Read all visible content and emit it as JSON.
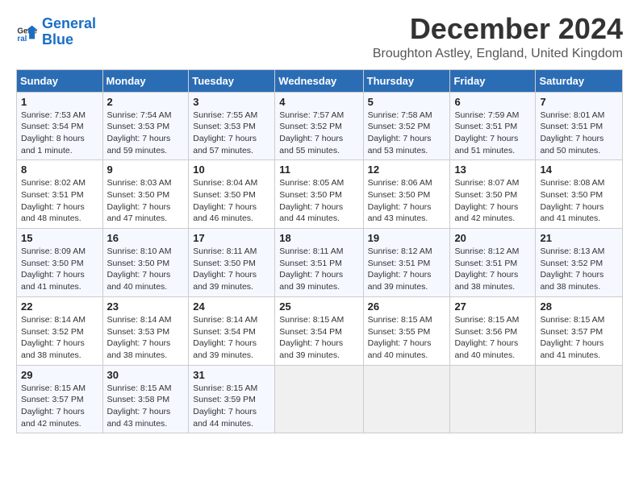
{
  "header": {
    "logo_line1": "General",
    "logo_line2": "Blue",
    "month": "December 2024",
    "location": "Broughton Astley, England, United Kingdom"
  },
  "days_of_week": [
    "Sunday",
    "Monday",
    "Tuesday",
    "Wednesday",
    "Thursday",
    "Friday",
    "Saturday"
  ],
  "weeks": [
    [
      {
        "day": "1",
        "info": "Sunrise: 7:53 AM\nSunset: 3:54 PM\nDaylight: 8 hours\nand 1 minute."
      },
      {
        "day": "2",
        "info": "Sunrise: 7:54 AM\nSunset: 3:53 PM\nDaylight: 7 hours\nand 59 minutes."
      },
      {
        "day": "3",
        "info": "Sunrise: 7:55 AM\nSunset: 3:53 PM\nDaylight: 7 hours\nand 57 minutes."
      },
      {
        "day": "4",
        "info": "Sunrise: 7:57 AM\nSunset: 3:52 PM\nDaylight: 7 hours\nand 55 minutes."
      },
      {
        "day": "5",
        "info": "Sunrise: 7:58 AM\nSunset: 3:52 PM\nDaylight: 7 hours\nand 53 minutes."
      },
      {
        "day": "6",
        "info": "Sunrise: 7:59 AM\nSunset: 3:51 PM\nDaylight: 7 hours\nand 51 minutes."
      },
      {
        "day": "7",
        "info": "Sunrise: 8:01 AM\nSunset: 3:51 PM\nDaylight: 7 hours\nand 50 minutes."
      }
    ],
    [
      {
        "day": "8",
        "info": "Sunrise: 8:02 AM\nSunset: 3:51 PM\nDaylight: 7 hours\nand 48 minutes."
      },
      {
        "day": "9",
        "info": "Sunrise: 8:03 AM\nSunset: 3:50 PM\nDaylight: 7 hours\nand 47 minutes."
      },
      {
        "day": "10",
        "info": "Sunrise: 8:04 AM\nSunset: 3:50 PM\nDaylight: 7 hours\nand 46 minutes."
      },
      {
        "day": "11",
        "info": "Sunrise: 8:05 AM\nSunset: 3:50 PM\nDaylight: 7 hours\nand 44 minutes."
      },
      {
        "day": "12",
        "info": "Sunrise: 8:06 AM\nSunset: 3:50 PM\nDaylight: 7 hours\nand 43 minutes."
      },
      {
        "day": "13",
        "info": "Sunrise: 8:07 AM\nSunset: 3:50 PM\nDaylight: 7 hours\nand 42 minutes."
      },
      {
        "day": "14",
        "info": "Sunrise: 8:08 AM\nSunset: 3:50 PM\nDaylight: 7 hours\nand 41 minutes."
      }
    ],
    [
      {
        "day": "15",
        "info": "Sunrise: 8:09 AM\nSunset: 3:50 PM\nDaylight: 7 hours\nand 41 minutes."
      },
      {
        "day": "16",
        "info": "Sunrise: 8:10 AM\nSunset: 3:50 PM\nDaylight: 7 hours\nand 40 minutes."
      },
      {
        "day": "17",
        "info": "Sunrise: 8:11 AM\nSunset: 3:50 PM\nDaylight: 7 hours\nand 39 minutes."
      },
      {
        "day": "18",
        "info": "Sunrise: 8:11 AM\nSunset: 3:51 PM\nDaylight: 7 hours\nand 39 minutes."
      },
      {
        "day": "19",
        "info": "Sunrise: 8:12 AM\nSunset: 3:51 PM\nDaylight: 7 hours\nand 39 minutes."
      },
      {
        "day": "20",
        "info": "Sunrise: 8:12 AM\nSunset: 3:51 PM\nDaylight: 7 hours\nand 38 minutes."
      },
      {
        "day": "21",
        "info": "Sunrise: 8:13 AM\nSunset: 3:52 PM\nDaylight: 7 hours\nand 38 minutes."
      }
    ],
    [
      {
        "day": "22",
        "info": "Sunrise: 8:14 AM\nSunset: 3:52 PM\nDaylight: 7 hours\nand 38 minutes."
      },
      {
        "day": "23",
        "info": "Sunrise: 8:14 AM\nSunset: 3:53 PM\nDaylight: 7 hours\nand 38 minutes."
      },
      {
        "day": "24",
        "info": "Sunrise: 8:14 AM\nSunset: 3:54 PM\nDaylight: 7 hours\nand 39 minutes."
      },
      {
        "day": "25",
        "info": "Sunrise: 8:15 AM\nSunset: 3:54 PM\nDaylight: 7 hours\nand 39 minutes."
      },
      {
        "day": "26",
        "info": "Sunrise: 8:15 AM\nSunset: 3:55 PM\nDaylight: 7 hours\nand 40 minutes."
      },
      {
        "day": "27",
        "info": "Sunrise: 8:15 AM\nSunset: 3:56 PM\nDaylight: 7 hours\nand 40 minutes."
      },
      {
        "day": "28",
        "info": "Sunrise: 8:15 AM\nSunset: 3:57 PM\nDaylight: 7 hours\nand 41 minutes."
      }
    ],
    [
      {
        "day": "29",
        "info": "Sunrise: 8:15 AM\nSunset: 3:57 PM\nDaylight: 7 hours\nand 42 minutes."
      },
      {
        "day": "30",
        "info": "Sunrise: 8:15 AM\nSunset: 3:58 PM\nDaylight: 7 hours\nand 43 minutes."
      },
      {
        "day": "31",
        "info": "Sunrise: 8:15 AM\nSunset: 3:59 PM\nDaylight: 7 hours\nand 44 minutes."
      },
      null,
      null,
      null,
      null
    ]
  ]
}
